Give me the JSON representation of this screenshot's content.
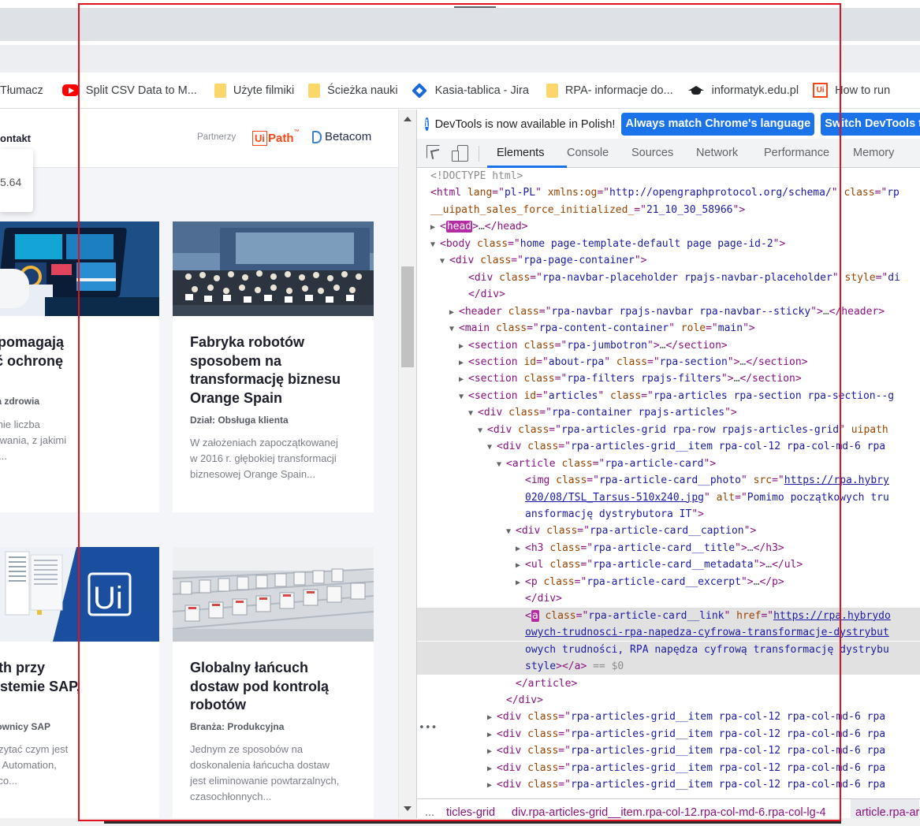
{
  "bookmarks": [
    {
      "label": "Tłumacz",
      "icon": "google-translate-icon"
    },
    {
      "label": "Split CSV Data to M...",
      "icon": "youtube-icon"
    },
    {
      "label": "Użyte filmiki",
      "icon": "folder-icon"
    },
    {
      "label": "Ścieżka nauki",
      "icon": "folder-icon"
    },
    {
      "label": "Kasia-tablica - Jira",
      "icon": "jira-icon"
    },
    {
      "label": "RPA- informacje do...",
      "icon": "folder-icon"
    },
    {
      "label": "informatyk.edu.pl",
      "icon": "graduation-cap-icon"
    },
    {
      "label": "How to run",
      "icon": "uipath-icon"
    }
  ],
  "site": {
    "nav_contact": "ontakt",
    "partners_label": "Partnerzy",
    "uipath_logo": {
      "ui": "Ui",
      "path": "Path",
      "tm": "™"
    },
    "betacom_logo": "Betacom",
    "price_popup": "5.64",
    "articles": [
      {
        "title": "roboty pomagają\nprawnić ochronę\nowia",
        "meta": "nża: Służba zdrowia",
        "excerpt": "arę jak rośnie liczba\nentów, wyzwania, z jakimi\nzą mierzyć..."
      },
      {
        "title": "Fabryka robotów\nsposobem na\ntransformację biznesu\nOrange Spain",
        "meta": "Dział: Obsługa klienta",
        "excerpt": "W założeniach zapoczątkowanej\nw 2016 r. głębokiej transformacji\nbiznesowej Orange Spain..."
      },
      {
        "title": "ot UiPath przy\ncy w systemie SAP,\nli...",
        "meta": "nża: Użytkownicy SAP",
        "excerpt": "ze jest poczytać czym jest\ntic Process Automation,\nedzieć się co..."
      },
      {
        "title": "Globalny łańcuch\ndostaw pod kontrolą\nrobotów",
        "meta": "Branża: Produkcyjna",
        "excerpt": "Jednym ze sposobów na\ndoskonalenia łańcucha dostaw\njest eliminowanie powtarzalnych,\nczasochłonnych..."
      }
    ]
  },
  "devtools": {
    "info_icon": "i",
    "info_text": "DevTools is now available in Polish!",
    "btn_match_language": "Always match Chrome's language",
    "btn_switch": "Switch DevTools t",
    "tabs": [
      "Elements",
      "Console",
      "Sources",
      "Network",
      "Performance",
      "Memory"
    ],
    "active_tab": "Elements",
    "more_dots": "•••",
    "breadcrumbs": [
      "...",
      "ticles-grid",
      "div.rpa-articles-grid__item.rpa-col-12.rpa-col-md-6.rpa-col-lg-4",
      "article.rpa-ar"
    ]
  },
  "dom_lines": [
    {
      "i": 0,
      "tw": "",
      "parts": [
        [
          "cm",
          "<!DOCTYPE html>"
        ]
      ]
    },
    {
      "i": 0,
      "tw": "",
      "parts": [
        [
          "tg",
          "<html "
        ],
        [
          "at",
          "lang"
        ],
        [
          "tg",
          "=\""
        ],
        [
          "av",
          "pl-PL"
        ],
        [
          "tg",
          "\" "
        ],
        [
          "at",
          "xmlns:og"
        ],
        [
          "tg",
          "=\""
        ],
        [
          "av",
          "http://opengraphprotocol.org/schema/"
        ],
        [
          "tg",
          "\" "
        ],
        [
          "at",
          "class"
        ],
        [
          "tg",
          "=\""
        ],
        [
          "av",
          "rp"
        ]
      ]
    },
    {
      "i": 0,
      "tw": "",
      "parts": [
        [
          "at",
          "__uipath_sales_force_initialized_"
        ],
        [
          "tg",
          "=\""
        ],
        [
          "av",
          "21_10_30_58966"
        ],
        [
          "tg",
          "\">"
        ]
      ]
    },
    {
      "i": 1,
      "tw": "▶",
      "parts": [
        [
          "tg",
          "<"
        ],
        [
          "hl",
          "head"
        ],
        [
          "tg",
          ">"
        ],
        [
          "ell",
          "…"
        ],
        [
          "tg",
          "</head>"
        ]
      ]
    },
    {
      "i": 1,
      "tw": "▼",
      "parts": [
        [
          "tg",
          "<body "
        ],
        [
          "at",
          "class"
        ],
        [
          "tg",
          "=\""
        ],
        [
          "av",
          "home page-template-default page page-id-2"
        ],
        [
          "tg",
          "\">"
        ]
      ]
    },
    {
      "i": 2,
      "tw": "▼",
      "parts": [
        [
          "tg",
          "<div "
        ],
        [
          "at",
          "class"
        ],
        [
          "tg",
          "=\""
        ],
        [
          "av",
          "rpa-page-container"
        ],
        [
          "tg",
          "\">"
        ]
      ]
    },
    {
      "i": 4,
      "tw": "",
      "parts": [
        [
          "tg",
          "<div "
        ],
        [
          "at",
          "class"
        ],
        [
          "tg",
          "=\""
        ],
        [
          "av",
          "rpa-navbar-placeholder rpajs-navbar-placeholder"
        ],
        [
          "tg",
          "\" "
        ],
        [
          "at",
          "style"
        ],
        [
          "tg",
          "=\""
        ],
        [
          "av",
          "di"
        ]
      ]
    },
    {
      "i": 4,
      "tw": "",
      "parts": [
        [
          "tg",
          "</div>"
        ]
      ]
    },
    {
      "i": 3,
      "tw": "▶",
      "parts": [
        [
          "tg",
          "<header "
        ],
        [
          "at",
          "class"
        ],
        [
          "tg",
          "=\""
        ],
        [
          "av",
          "rpa-navbar rpajs-navbar rpa-navbar--sticky"
        ],
        [
          "tg",
          "\">"
        ],
        [
          "ell",
          "…"
        ],
        [
          "tg",
          "</header>"
        ]
      ]
    },
    {
      "i": 3,
      "tw": "▼",
      "parts": [
        [
          "tg",
          "<main "
        ],
        [
          "at",
          "class"
        ],
        [
          "tg",
          "=\""
        ],
        [
          "av",
          "rpa-content-container"
        ],
        [
          "tg",
          "\" "
        ],
        [
          "at",
          "role"
        ],
        [
          "tg",
          "=\""
        ],
        [
          "av",
          "main"
        ],
        [
          "tg",
          "\">"
        ]
      ]
    },
    {
      "i": 4,
      "tw": "▶",
      "parts": [
        [
          "tg",
          "<section "
        ],
        [
          "at",
          "class"
        ],
        [
          "tg",
          "=\""
        ],
        [
          "av",
          "rpa-jumbotron"
        ],
        [
          "tg",
          "\">"
        ],
        [
          "ell",
          "…"
        ],
        [
          "tg",
          "</section>"
        ]
      ]
    },
    {
      "i": 4,
      "tw": "▶",
      "parts": [
        [
          "tg",
          "<section "
        ],
        [
          "at",
          "id"
        ],
        [
          "tg",
          "=\""
        ],
        [
          "av",
          "about-rpa"
        ],
        [
          "tg",
          "\" "
        ],
        [
          "at",
          "class"
        ],
        [
          "tg",
          "=\""
        ],
        [
          "av",
          "rpa-section"
        ],
        [
          "tg",
          "\">"
        ],
        [
          "ell",
          "…"
        ],
        [
          "tg",
          "</section>"
        ]
      ]
    },
    {
      "i": 4,
      "tw": "▶",
      "parts": [
        [
          "tg",
          "<section "
        ],
        [
          "at",
          "class"
        ],
        [
          "tg",
          "=\""
        ],
        [
          "av",
          "rpa-filters rpajs-filters"
        ],
        [
          "tg",
          "\">"
        ],
        [
          "ell",
          "…"
        ],
        [
          "tg",
          "</section>"
        ]
      ]
    },
    {
      "i": 4,
      "tw": "▼",
      "parts": [
        [
          "tg",
          "<section "
        ],
        [
          "at",
          "id"
        ],
        [
          "tg",
          "=\""
        ],
        [
          "av",
          "articles"
        ],
        [
          "tg",
          "\" "
        ],
        [
          "at",
          "class"
        ],
        [
          "tg",
          "=\""
        ],
        [
          "av",
          "rpa-articles rpa-section rpa-section--g"
        ]
      ]
    },
    {
      "i": 5,
      "tw": "▼",
      "parts": [
        [
          "tg",
          "<div "
        ],
        [
          "at",
          "class"
        ],
        [
          "tg",
          "=\""
        ],
        [
          "av",
          "rpa-container rpajs-articles"
        ],
        [
          "tg",
          "\">"
        ]
      ]
    },
    {
      "i": 6,
      "tw": "▼",
      "parts": [
        [
          "tg",
          "<div "
        ],
        [
          "at",
          "class"
        ],
        [
          "tg",
          "=\""
        ],
        [
          "av",
          "rpa-articles-grid rpa-row rpajs-articles-grid"
        ],
        [
          "tg",
          "\" "
        ],
        [
          "at",
          "uipath"
        ]
      ]
    },
    {
      "i": 7,
      "tw": "▼",
      "parts": [
        [
          "tg",
          "<div "
        ],
        [
          "at",
          "class"
        ],
        [
          "tg",
          "=\""
        ],
        [
          "av",
          "rpa-articles-grid__item rpa-col-12 rpa-col-md-6 rpa"
        ]
      ]
    },
    {
      "i": 8,
      "tw": "▼",
      "parts": [
        [
          "tg",
          "<article "
        ],
        [
          "at",
          "class"
        ],
        [
          "tg",
          "=\""
        ],
        [
          "av",
          "rpa-article-card"
        ],
        [
          "tg",
          "\">"
        ]
      ]
    },
    {
      "i": 10,
      "tw": "",
      "parts": [
        [
          "tg",
          "<img "
        ],
        [
          "at",
          "class"
        ],
        [
          "tg",
          "=\""
        ],
        [
          "av",
          "rpa-article-card__photo"
        ],
        [
          "tg",
          "\" "
        ],
        [
          "at",
          "src"
        ],
        [
          "tg",
          "=\""
        ],
        [
          "lk",
          "https://rpa.hybry"
        ]
      ]
    },
    {
      "i": 10,
      "tw": "",
      "parts": [
        [
          "lk",
          "020/08/TSL_Tarsus-510x240.jpg"
        ],
        [
          "tg",
          "\" "
        ],
        [
          "at",
          "alt"
        ],
        [
          "tg",
          "=\""
        ],
        [
          "av",
          "Pomimo początkowych tru"
        ]
      ]
    },
    {
      "i": 10,
      "tw": "",
      "parts": [
        [
          "av",
          "ansformację dystrybutora IT"
        ],
        [
          "tg",
          "\">"
        ]
      ]
    },
    {
      "i": 9,
      "tw": "▼",
      "parts": [
        [
          "tg",
          "<div "
        ],
        [
          "at",
          "class"
        ],
        [
          "tg",
          "=\""
        ],
        [
          "av",
          "rpa-article-card__caption"
        ],
        [
          "tg",
          "\">"
        ]
      ]
    },
    {
      "i": 10,
      "tw": "▶",
      "parts": [
        [
          "tg",
          "<h3 "
        ],
        [
          "at",
          "class"
        ],
        [
          "tg",
          "=\""
        ],
        [
          "av",
          "rpa-article-card__title"
        ],
        [
          "tg",
          "\">"
        ],
        [
          "ell",
          "…"
        ],
        [
          "tg",
          "</h3>"
        ]
      ]
    },
    {
      "i": 10,
      "tw": "▶",
      "parts": [
        [
          "tg",
          "<ul "
        ],
        [
          "at",
          "class"
        ],
        [
          "tg",
          "=\""
        ],
        [
          "av",
          "rpa-article-card__metadata"
        ],
        [
          "tg",
          "\">"
        ],
        [
          "ell",
          "…"
        ],
        [
          "tg",
          "</ul>"
        ]
      ]
    },
    {
      "i": 10,
      "tw": "▶",
      "parts": [
        [
          "tg",
          "<p "
        ],
        [
          "at",
          "class"
        ],
        [
          "tg",
          "=\""
        ],
        [
          "av",
          "rpa-article-card__excerpt"
        ],
        [
          "tg",
          "\">"
        ],
        [
          "ell",
          "…"
        ],
        [
          "tg",
          "</p>"
        ]
      ]
    },
    {
      "i": 10,
      "tw": "",
      "parts": [
        [
          "tg",
          "</div>"
        ]
      ]
    },
    {
      "i": 10,
      "tw": "",
      "sel": true,
      "parts": [
        [
          "tg",
          "<"
        ],
        [
          "hl",
          "a"
        ],
        [
          "tg",
          " "
        ],
        [
          "at",
          "class"
        ],
        [
          "tg",
          "=\""
        ],
        [
          "av",
          "rpa-article-card__link"
        ],
        [
          "tg",
          "\" "
        ],
        [
          "at",
          "href"
        ],
        [
          "tg",
          "=\""
        ],
        [
          "lk",
          "https://rpa.hybrydo"
        ]
      ]
    },
    {
      "i": 10,
      "tw": "",
      "sel": true,
      "parts": [
        [
          "lk",
          "owych-trudnosci-rpa-napedza-cyfrowa-transformacje-dystrybut"
        ]
      ]
    },
    {
      "i": 10,
      "tw": "",
      "sel": true,
      "parts": [
        [
          "av",
          "owych trudności, RPA napędza cyfrową transformację dystrybu"
        ]
      ]
    },
    {
      "i": 10,
      "tw": "",
      "sel": true,
      "parts": [
        [
          "av",
          "style"
        ],
        [
          "tg",
          "></a>"
        ],
        [
          "cm",
          " == $0"
        ]
      ]
    },
    {
      "i": 9,
      "tw": "",
      "parts": [
        [
          "tg",
          "</article>"
        ]
      ]
    },
    {
      "i": 8,
      "tw": "",
      "parts": [
        [
          "tg",
          "</div>"
        ]
      ]
    },
    {
      "i": 7,
      "tw": "▶",
      "parts": [
        [
          "tg",
          "<div "
        ],
        [
          "at",
          "class"
        ],
        [
          "tg",
          "=\""
        ],
        [
          "av",
          "rpa-articles-grid__item rpa-col-12 rpa-col-md-6 rpa"
        ]
      ]
    },
    {
      "i": 7,
      "tw": "▶",
      "parts": [
        [
          "tg",
          "<div "
        ],
        [
          "at",
          "class"
        ],
        [
          "tg",
          "=\""
        ],
        [
          "av",
          "rpa-articles-grid__item rpa-col-12 rpa-col-md-6 rpa"
        ]
      ]
    },
    {
      "i": 7,
      "tw": "▶",
      "parts": [
        [
          "tg",
          "<div "
        ],
        [
          "at",
          "class"
        ],
        [
          "tg",
          "=\""
        ],
        [
          "av",
          "rpa-articles-grid__item rpa-col-12 rpa-col-md-6 rpa"
        ]
      ]
    },
    {
      "i": 7,
      "tw": "▶",
      "parts": [
        [
          "tg",
          "<div "
        ],
        [
          "at",
          "class"
        ],
        [
          "tg",
          "=\""
        ],
        [
          "av",
          "rpa-articles-grid__item rpa-col-12 rpa-col-md-6 rpa"
        ]
      ]
    },
    {
      "i": 7,
      "tw": "▶",
      "parts": [
        [
          "tg",
          "<div "
        ],
        [
          "at",
          "class"
        ],
        [
          "tg",
          "=\""
        ],
        [
          "av",
          "rpa-articles-grid__item rpa-col-12 rpa-col-md-6 rpa"
        ]
      ]
    }
  ],
  "colors": {
    "accent": "#1a73e8",
    "uipath_orange": "#fa4616",
    "annotation_red": "#e0121f",
    "tag_purple": "#881280",
    "attr_brown": "#994500",
    "value_blue": "#1a1aa6"
  }
}
